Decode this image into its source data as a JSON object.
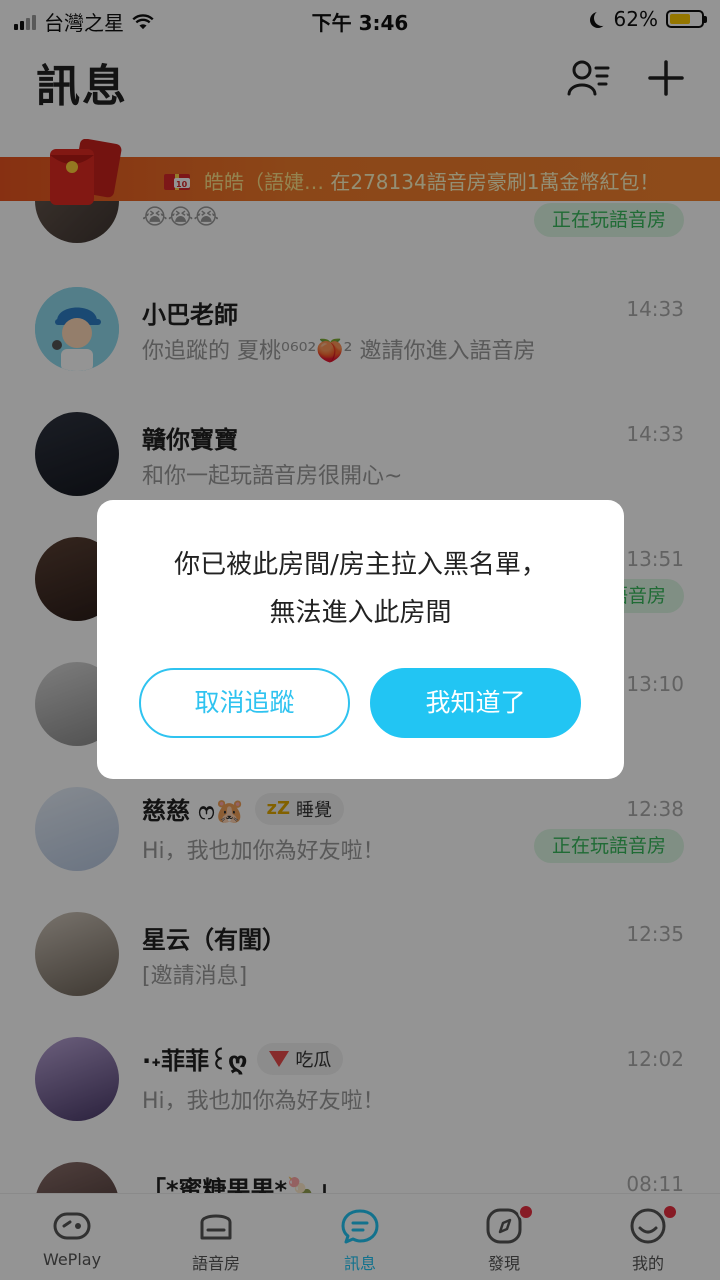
{
  "status_bar": {
    "carrier": "台灣之星",
    "time": "下午 3:46",
    "battery": "62%",
    "battery_level": 0.62
  },
  "header": {
    "title": "訊息",
    "friends_icon": "friends-list-icon",
    "add_icon": "plus-icon"
  },
  "banner": {
    "text_name": "皓皓（語婕…",
    "text_rest": "在278134語音房豪刷1萬金幣紅包！"
  },
  "conversations": [
    {
      "name": "",
      "message": "😭😭😭",
      "time": "",
      "playing": "正在玩語音房"
    },
    {
      "name": "小巴老師",
      "message": "你追蹤的 夏桃⁰⁶⁰²🍑² 邀請你進入語音房",
      "time": "14:33"
    },
    {
      "name": "贛你寶寶",
      "message": "和你一起玩語音房很開心~",
      "time": "14:33"
    },
    {
      "name": "",
      "message": "",
      "time": "13:51",
      "playing": "正在玩語音房"
    },
    {
      "name": "",
      "message": "",
      "time": "13:10"
    },
    {
      "name": "慈慈 ෆ🐹",
      "status": "睡覺",
      "message": "Hi，我也加你為好友啦！",
      "time": "12:38",
      "playing": "正在玩語音房"
    },
    {
      "name": "星云（有閨）",
      "message": "[邀請消息]",
      "time": "12:35"
    },
    {
      "name": "·˖菲菲꒰ღ",
      "status": "吃瓜",
      "message": "Hi，我也加你為好友啦！",
      "time": "12:02"
    },
    {
      "name": "「*蜜糖果果*🍡」",
      "message": "",
      "time": "08:11"
    }
  ],
  "tabbar": [
    {
      "label": "WePlay",
      "icon": "game-controller-icon"
    },
    {
      "label": "語音房",
      "icon": "sofa-icon"
    },
    {
      "label": "訊息",
      "icon": "chat-bubble-icon",
      "active": true
    },
    {
      "label": "發現",
      "icon": "compass-icon",
      "badge": true
    },
    {
      "label": "我的",
      "icon": "smile-face-icon",
      "badge": true
    }
  ],
  "dialog": {
    "line1": "你已被此房間/房主拉入黑名單，",
    "line2": "無法進入此房間",
    "cancel_label": "取消追蹤",
    "ok_label": "我知道了"
  },
  "colors": {
    "accent": "#22c5f3",
    "banner": "#f07a2a",
    "playing_text": "#37b85c",
    "badge": "#e83040"
  }
}
